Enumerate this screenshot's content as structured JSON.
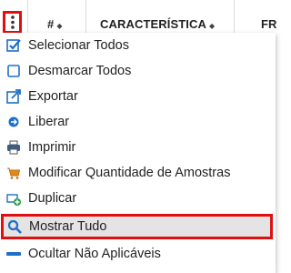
{
  "header": {
    "columns": [
      {
        "label": "#"
      },
      {
        "label": "CARACTERÍSTICA"
      },
      {
        "label": "FR"
      }
    ],
    "sort_glyph": "◆"
  },
  "menu": {
    "items": [
      {
        "label": "Selecionar Todos",
        "icon": "checked-checkbox-icon"
      },
      {
        "label": "Desmarcar Todos",
        "icon": "empty-checkbox-icon"
      },
      {
        "label": "Exportar",
        "icon": "export-icon"
      },
      {
        "label": "Liberar",
        "icon": "arrow-right-circle-icon"
      },
      {
        "label": "Imprimir",
        "icon": "printer-icon"
      },
      {
        "label": "Modificar Quantidade de Amostras",
        "icon": "cart-icon"
      },
      {
        "label": "Duplicar",
        "icon": "duplicate-icon"
      },
      {
        "label": "Mostrar Tudo",
        "icon": "search-icon",
        "highlighted": true
      },
      {
        "label": "Ocultar Não Aplicáveis",
        "icon": "minus-icon"
      }
    ]
  },
  "colors": {
    "highlight_border": "#e01010",
    "highlight_bg": "#e4e4e4",
    "icon_blue": "#1e6fc8",
    "cart_orange": "#e08a1e",
    "duplicate_green": "#2e9a4a"
  }
}
